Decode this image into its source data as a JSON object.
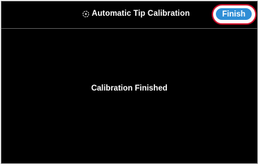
{
  "header": {
    "title": "Automatic Tip Calibration",
    "title_icon": "calibration-target-icon",
    "finish_label": "Finish"
  },
  "main": {
    "status_message": "Calibration Finished"
  },
  "colors": {
    "background": "#000000",
    "finish_button": "#2f8ed6",
    "highlight_ring": "#d0102c"
  }
}
